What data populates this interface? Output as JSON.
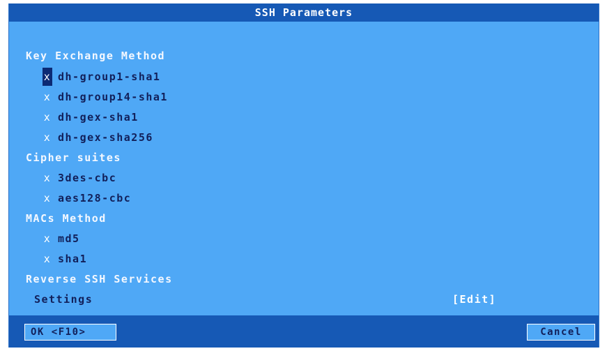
{
  "title": "SSH Parameters",
  "sections": [
    {
      "label": "Key Exchange Method",
      "options": [
        {
          "mark": "x",
          "label": "dh-group1-sha1"
        },
        {
          "mark": "x",
          "label": "dh-group14-sha1"
        },
        {
          "mark": "x",
          "label": "dh-gex-sha1"
        },
        {
          "mark": "x",
          "label": "dh-gex-sha256"
        }
      ]
    },
    {
      "label": "Cipher suites",
      "options": [
        {
          "mark": "x",
          "label": "3des-cbc"
        },
        {
          "mark": "x",
          "label": "aes128-cbc"
        }
      ]
    },
    {
      "label": "MACs Method",
      "options": [
        {
          "mark": "x",
          "label": "md5"
        },
        {
          "mark": "x",
          "label": "sha1"
        }
      ]
    },
    {
      "label": "Reverse SSH Services",
      "options": []
    }
  ],
  "settings": {
    "label": "Settings",
    "edit_label": "[Edit]"
  },
  "buttons": {
    "ok_label": "OK <F10>",
    "cancel_label": "Cancel"
  },
  "colors": {
    "dialog_bg": "#4fa8f6",
    "bar_bg": "#1659b5",
    "focus_bg": "#0c2a74"
  }
}
